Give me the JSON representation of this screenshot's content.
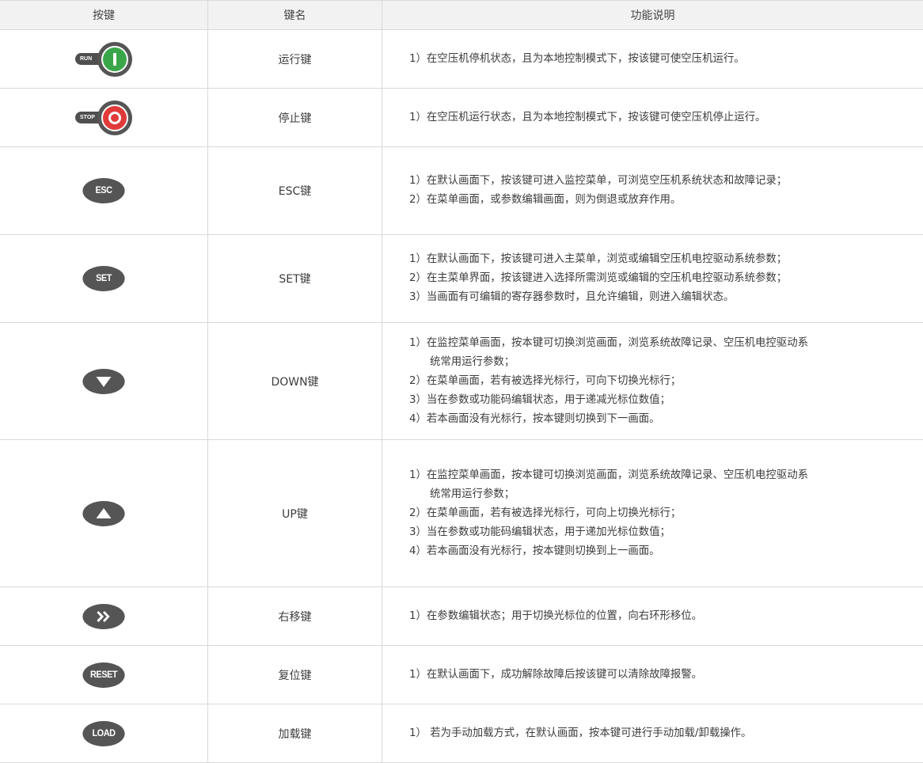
{
  "header": {
    "col1": "按键",
    "col2": "键名",
    "col3": "功能说明"
  },
  "rows": [
    {
      "icon": "run-key-icon",
      "icon_label": "RUN",
      "icon_color": "#3aa64a",
      "name": "运行键",
      "lines": [
        "1）在空压机停机状态，且为本地控制模式下，按该键可使空压机运行。"
      ]
    },
    {
      "icon": "stop-key-icon",
      "icon_label": "STOP",
      "icon_color": "#e03a3a",
      "name": "停止键",
      "lines": [
        "1）在空压机运行状态，且为本地控制模式下，按该键可使空压机停止运行。"
      ]
    },
    {
      "icon": "esc-key-icon",
      "icon_label": "ESC",
      "name": "ESC键",
      "lines": [
        "1）在默认画面下，按该键可进入监控菜单，可浏览空压机系统状态和故障记录；",
        "2）在菜单画面，或参数编辑画面，则为倒退或放弃作用。"
      ]
    },
    {
      "icon": "set-key-icon",
      "icon_label": "SET",
      "name": "SET键",
      "lines": [
        "1）在默认画面下，按该键可进入主菜单，浏览或编辑空压机电控驱动系统参数；",
        "2）在主菜单界面，按该键进入选择所需浏览或编辑的空压机电控驱动系统参数；",
        "3）当画面有可编辑的寄存器参数时，且允许编辑，则进入编辑状态。"
      ]
    },
    {
      "icon": "down-arrow-key-icon",
      "name": "DOWN键",
      "lines": [
        "1）在监控菜单画面，按本键可切换浏览画面，浏览系统故障记录、空压机电控驱动系",
        "统常用运行参数；",
        "2）在菜单画面，若有被选择光标行，可向下切换光标行；",
        "3）当在参数或功能码编辑状态，用于递减光标位数值；",
        "4）若本画面没有光标行，按本键则切换到下一画面。"
      ]
    },
    {
      "icon": "up-arrow-key-icon",
      "name": "UP键",
      "lines": [
        "1）在监控菜单画面，按本键可切换浏览画面，浏览系统故障记录、空压机电控驱动系",
        "统常用运行参数；",
        "2）在菜单画面，若有被选择光标行，可向上切换光标行；",
        "3）当在参数或功能码编辑状态，用于递加光标位数值；",
        "4）若本画面没有光标行，按本键则切换到上一画面。"
      ]
    },
    {
      "icon": "shift-right-key-icon",
      "name": "右移键",
      "lines": [
        "1）在参数编辑状态；用于切换光标位的位置，向右环形移位。"
      ]
    },
    {
      "icon": "reset-key-icon",
      "icon_label": "RESET",
      "name": "复位键",
      "lines": [
        "1）在默认画面下，成功解除故障后按该键可以清除故障报警。"
      ]
    },
    {
      "icon": "load-key-icon",
      "icon_label": "LOAD",
      "name": "加载键",
      "lines": [
        "1） 若为手动加载方式，在默认画面，按本键可进行手动加载/卸载操作。"
      ]
    }
  ]
}
